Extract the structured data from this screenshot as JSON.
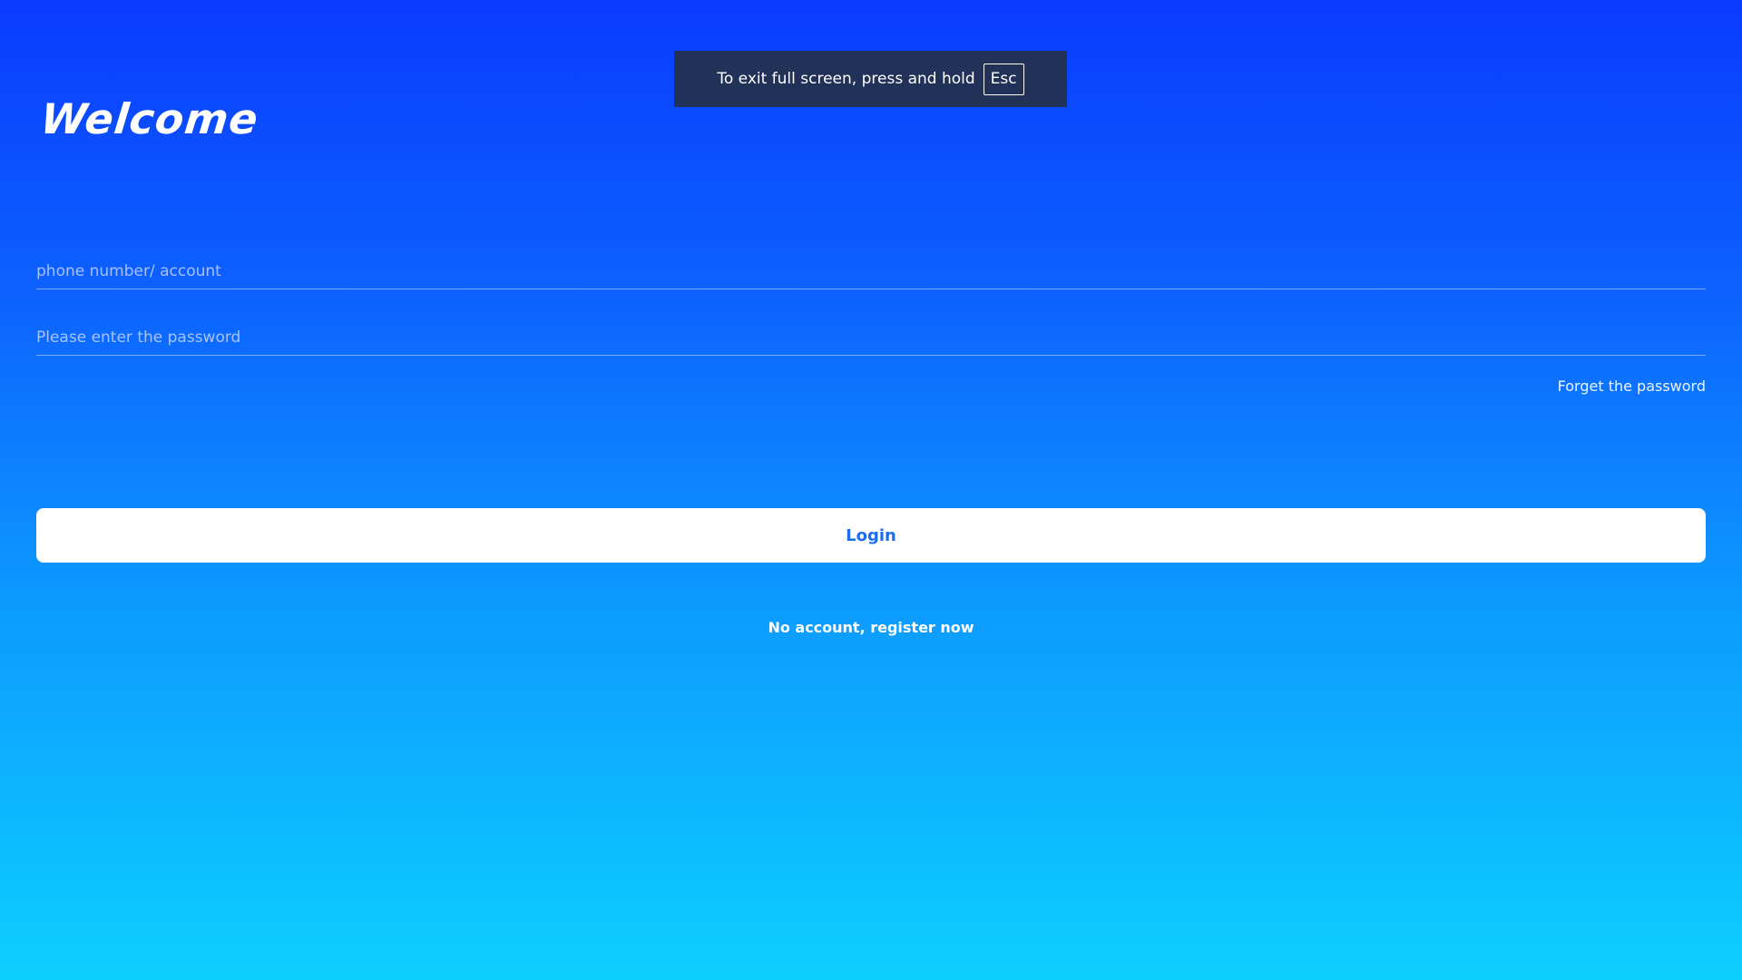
{
  "colors": {
    "gradient_top": "#0a3bff",
    "gradient_bottom": "#0dcfff",
    "button_text": "#1d6df3",
    "toast_bg": "#213157"
  },
  "header": {
    "title": "Welcome"
  },
  "form": {
    "account_placeholder": "phone number/ account",
    "account_value": "",
    "password_placeholder": "Please enter the password",
    "password_value": "",
    "forget_label": "Forget the password",
    "login_label": "Login",
    "register_label": "No account, register now"
  },
  "fullscreen_notice": {
    "text": "To exit full screen, press and hold",
    "key": "Esc"
  }
}
